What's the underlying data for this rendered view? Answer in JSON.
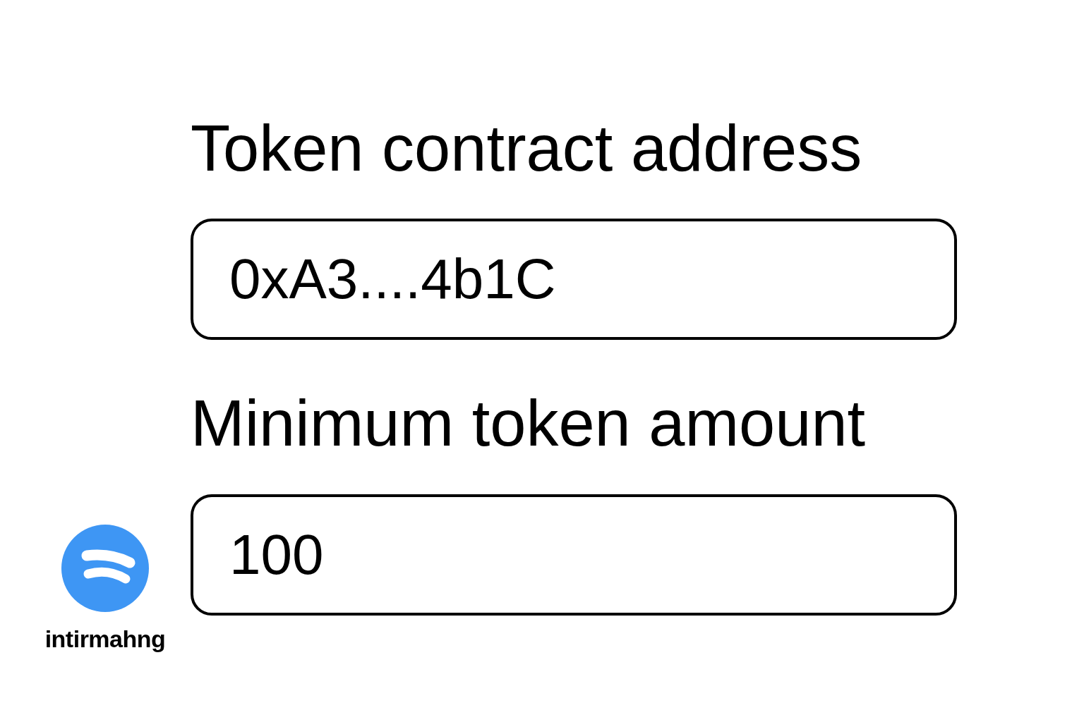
{
  "fields": [
    {
      "label": "Token contract address",
      "value": "0xA3....4b1C"
    },
    {
      "label": "Minimum token amount",
      "value": "100"
    }
  ],
  "logo": {
    "name": "intirmahng"
  }
}
